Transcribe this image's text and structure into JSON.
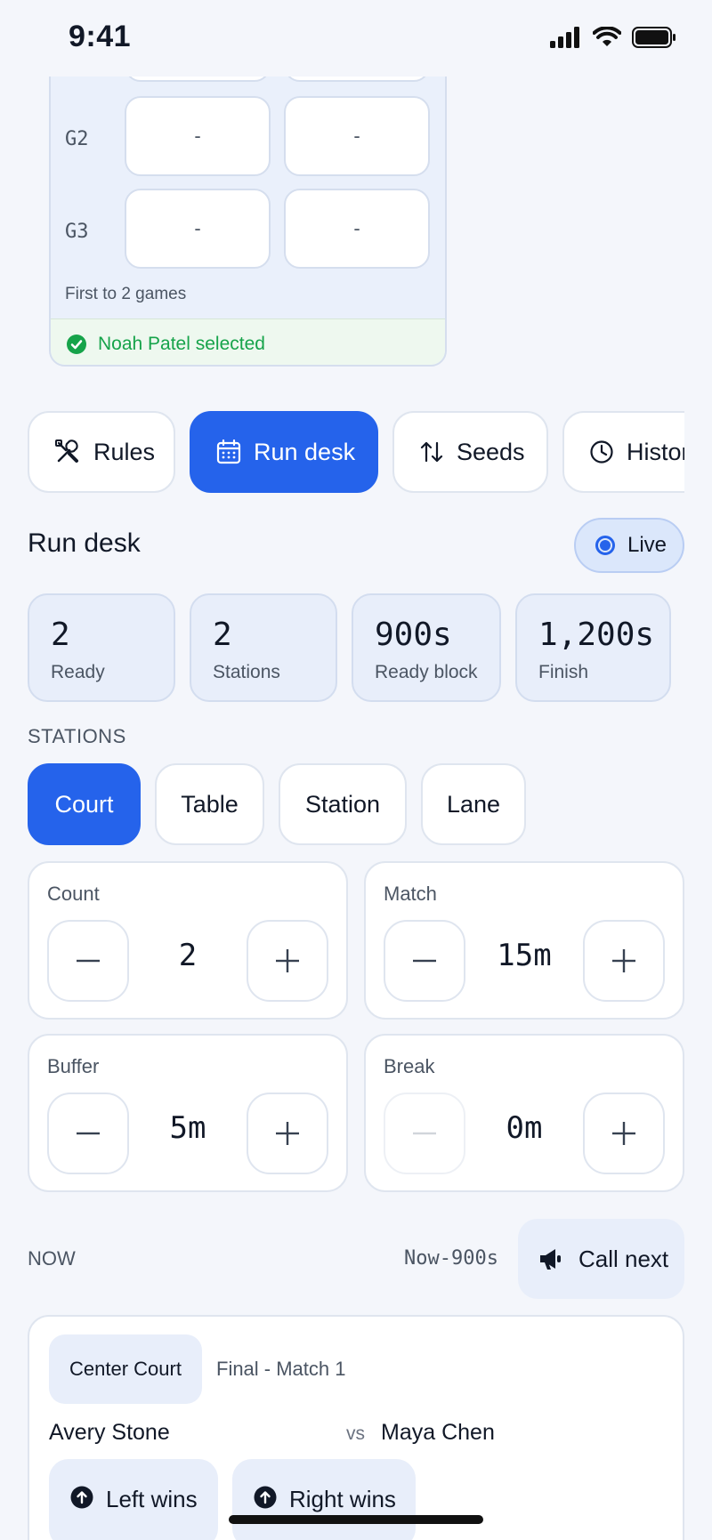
{
  "status_bar": {
    "time": "9:41"
  },
  "score_card": {
    "rows": [
      {
        "label": "G2",
        "left": "-",
        "right": "-"
      },
      {
        "label": "G3",
        "left": "-",
        "right": "-"
      }
    ],
    "first_to": "First to 2 games",
    "selected": "Noah Patel selected"
  },
  "tabs": [
    {
      "label": "Rules",
      "icon": "tools-icon"
    },
    {
      "label": "Run desk",
      "icon": "calendar-icon"
    },
    {
      "label": "Seeds",
      "icon": "sort-arrows-icon"
    },
    {
      "label": "History",
      "icon": "clock-icon"
    }
  ],
  "run_desk": {
    "title": "Run desk",
    "live_label": "Live",
    "stats": [
      {
        "value": "2",
        "label": "Ready"
      },
      {
        "value": "2",
        "label": "Stations"
      },
      {
        "value": "900s",
        "label": "Ready block"
      },
      {
        "value": "1,200s",
        "label": "Finish"
      }
    ],
    "stations_label": "STATIONS",
    "station_types": [
      "Court",
      "Table",
      "Station",
      "Lane"
    ],
    "selected_station_type": "Court",
    "steppers": [
      {
        "label": "Count",
        "value": "2"
      },
      {
        "label": "Match",
        "value": "15m"
      },
      {
        "label": "Buffer",
        "value": "5m"
      },
      {
        "label": "Break",
        "value": "0m"
      }
    ]
  },
  "now": {
    "label": "NOW",
    "time": "Now-900s",
    "call_next": "Call next",
    "match": {
      "court": "Center Court",
      "name": "Final - Match 1",
      "player_left": "Avery Stone",
      "vs": "vs",
      "player_right": "Maya Chen",
      "left_wins": "Left wins",
      "right_wins": "Right wins"
    }
  },
  "colors": {
    "accent": "#2563eb",
    "success": "#16a34a",
    "card_tint": "#e8eefa"
  }
}
